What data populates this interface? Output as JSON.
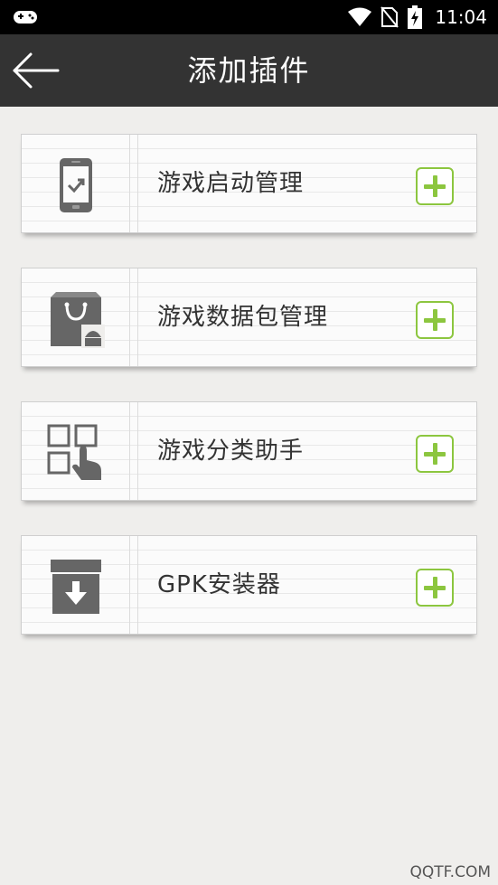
{
  "status_bar": {
    "time": "11:04",
    "icons": [
      "gamepad-icon",
      "wifi-icon",
      "no-sim-icon",
      "battery-charging-icon"
    ]
  },
  "header": {
    "title": "添加插件",
    "back_icon": "arrow-left-icon"
  },
  "plugins": [
    {
      "label": "游戏启动管理",
      "icon": "phone-check-icon"
    },
    {
      "label": "游戏数据包管理",
      "icon": "shopping-bag-android-icon"
    },
    {
      "label": "游戏分类助手",
      "icon": "grid-hand-icon"
    },
    {
      "label": "GPK安装器",
      "icon": "box-download-icon"
    }
  ],
  "add_icon": "plus-icon",
  "watermark": "QQTF.COM",
  "colors": {
    "accent": "#8cc63f",
    "appbar": "#333333",
    "statusbar": "#000000",
    "icon_gray": "#666666"
  }
}
